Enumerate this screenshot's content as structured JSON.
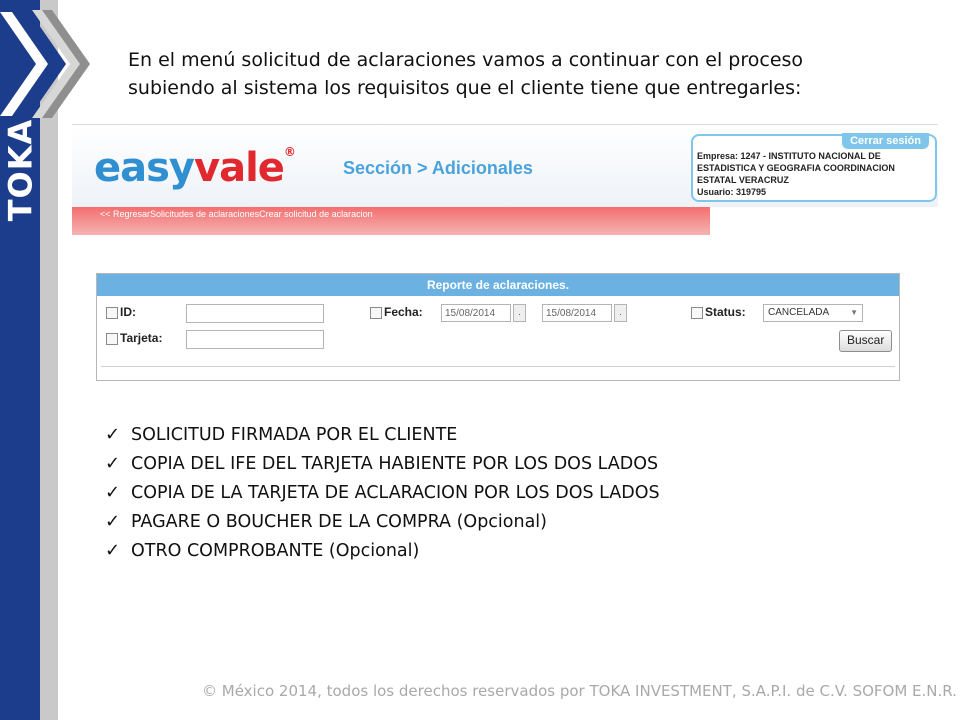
{
  "brand": {
    "word": "TOKA",
    "bar_color": "#1c3c8c",
    "accent_color": "#c9c9c9"
  },
  "intro": {
    "line1": "En el menú solicitud de aclaraciones vamos a continuar con el proceso",
    "line2": "subiendo al sistema los requisitos que el cliente tiene que entregarles:"
  },
  "app": {
    "logo": {
      "part1": "easy",
      "part2": "vale",
      "mark": "®"
    },
    "section_title": "Sección > Adicionales",
    "session": {
      "logout": "Cerrar sesión",
      "line1": "Empresa: 1247 - INSTITUTO NACIONAL DE",
      "line2": "ESTADISTICA Y GEOGRAFIA COORDINACION",
      "line3": "ESTATAL VERACRUZ",
      "line4": "Usuario: 319795"
    },
    "nav": {
      "back": "<< Regresar",
      "item1": "Solicitudes de aclaraciones",
      "item2": "Crear solicitud de aclaracion"
    },
    "report": {
      "title": "Reporte de aclaraciones.",
      "id_label": "ID:",
      "card_label": "Tarjeta:",
      "date_label": "Fecha:",
      "date_from": "15/08/2014",
      "date_to": "15/08/2014",
      "date_button": ".",
      "status_label": "Status:",
      "status_value": "CANCELADA",
      "search_button": "Buscar"
    }
  },
  "requirements": [
    "SOLICITUD FIRMADA POR EL CLIENTE",
    "COPIA DEL IFE DEL TARJETA HABIENTE POR LOS DOS LADOS",
    "COPIA DE LA TARJETA DE ACLARACION POR LOS DOS LADOS",
    "PAGARE O BOUCHER DE LA COMPRA (Opcional)",
    "OTRO COMPROBANTE (Opcional)"
  ],
  "footer": "© México 2014, todos los derechos reservados por TOKA INVESTMENT, S.A.P.I. de C.V. SOFOM E.N.R."
}
